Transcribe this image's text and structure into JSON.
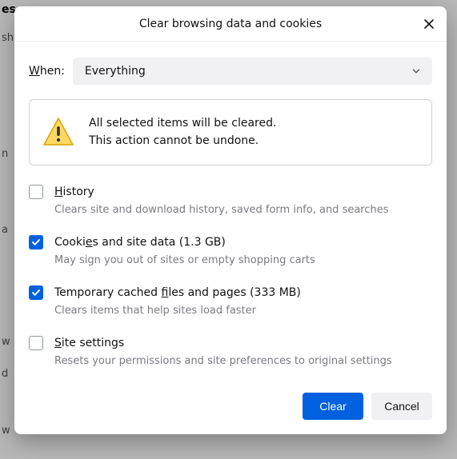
{
  "dialog": {
    "title": "Clear browsing data and cookies",
    "when_label_pre": "W",
    "when_label_rest": "hen:",
    "dropdown_value": "Everything",
    "alert_line1": "All selected items will be cleared.",
    "alert_line2": "This action cannot be undone.",
    "options": [
      {
        "checked": false,
        "label_ul": "H",
        "label_rest": "istory",
        "desc": "Clears site and download history, saved form info, and searches"
      },
      {
        "checked": true,
        "label_pre": "Cooki",
        "label_ul": "e",
        "label_rest": "s and site data (1.3 GB)",
        "desc": "May sign you out of sites or empty shopping carts"
      },
      {
        "checked": true,
        "label_pre": "Temporary cached ",
        "label_ul": "f",
        "label_rest": "iles and pages (333 MB)",
        "desc": "Clears items that help sites load faster"
      },
      {
        "checked": false,
        "label_ul": "S",
        "label_rest": "ite settings",
        "desc": "Resets your permissions and site preferences to original settings"
      }
    ],
    "primary_button": "Clear",
    "secondary_button": "Cancel"
  },
  "bg": {
    "es": "es",
    "sh": "sh",
    "n": "n",
    "a": "a",
    "w1": "w",
    "d": "d",
    "w2": "w"
  }
}
